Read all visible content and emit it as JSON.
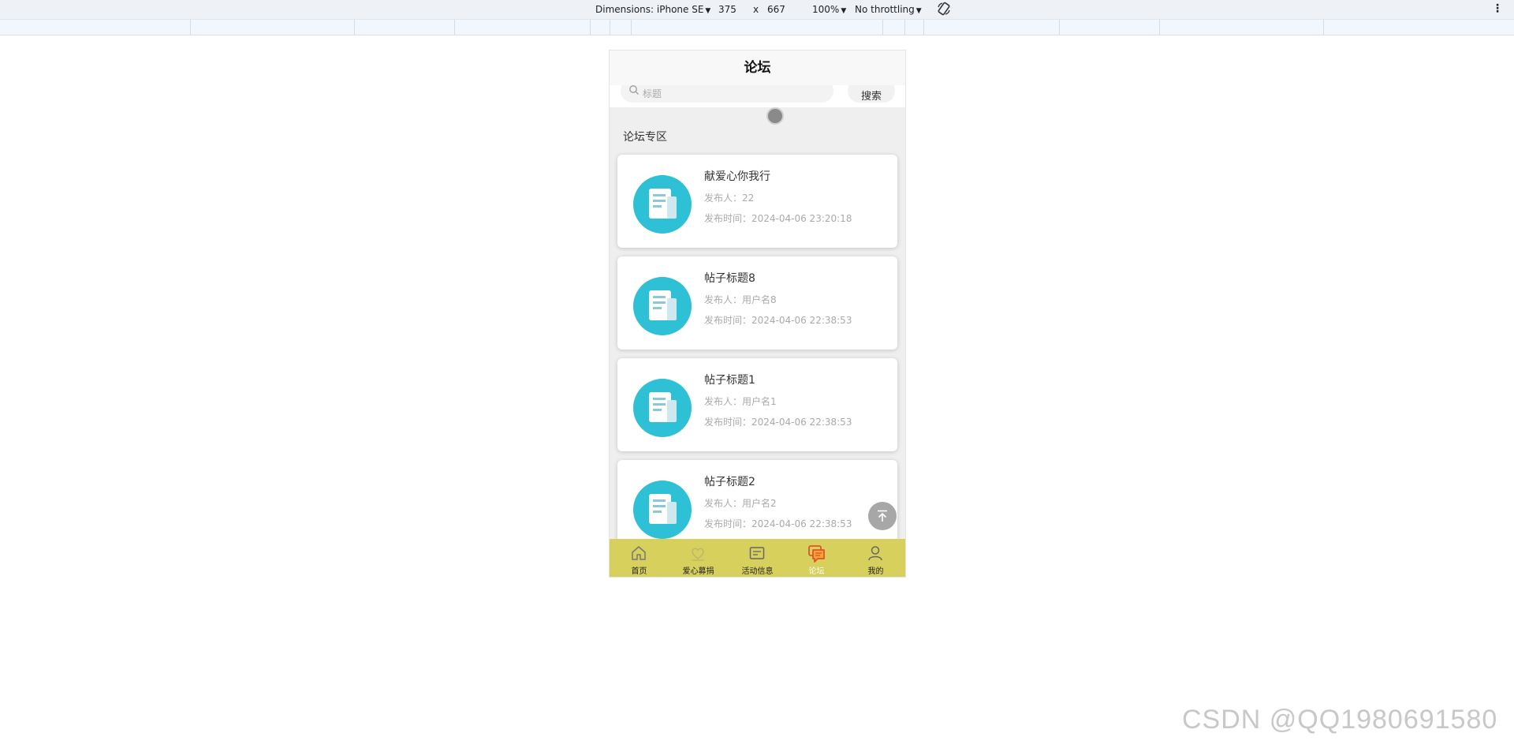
{
  "devtools": {
    "dimensions_label": "Dimensions: iPhone SE",
    "width": "375",
    "times": "x",
    "height": "667",
    "zoom": "100%",
    "throttling": "No throttling"
  },
  "app": {
    "nav_title": "论坛",
    "search": {
      "placeholder": "标题",
      "button_label": "搜索"
    },
    "section_title": "论坛专区",
    "posts": [
      {
        "title": "献爱心你我行",
        "author_label": "发布人：22",
        "time_label": "发布时间：2024-04-06 23:20:18"
      },
      {
        "title": "帖子标题8",
        "author_label": "发布人：用户名8",
        "time_label": "发布时间：2024-04-06 22:38:53"
      },
      {
        "title": "帖子标题1",
        "author_label": "发布人：用户名1",
        "time_label": "发布时间：2024-04-06 22:38:53"
      },
      {
        "title": "帖子标题2",
        "author_label": "发布人：用户名2",
        "time_label": "发布时间：2024-04-06 22:38:53"
      }
    ],
    "tabbar": {
      "tabs": [
        {
          "label": "首页",
          "icon": "home-icon"
        },
        {
          "label": "爱心募捐",
          "icon": "heart-icon"
        },
        {
          "label": "活动信息",
          "icon": "activity-icon"
        },
        {
          "label": "论坛",
          "icon": "forum-icon",
          "active": true
        },
        {
          "label": "我的",
          "icon": "user-icon"
        }
      ]
    },
    "colors": {
      "tabbar": "#d8d05c",
      "accent_icon": "#2ec0d4",
      "active_tab": "#e2522a"
    }
  },
  "watermark": "CSDN @QQ1980691580"
}
